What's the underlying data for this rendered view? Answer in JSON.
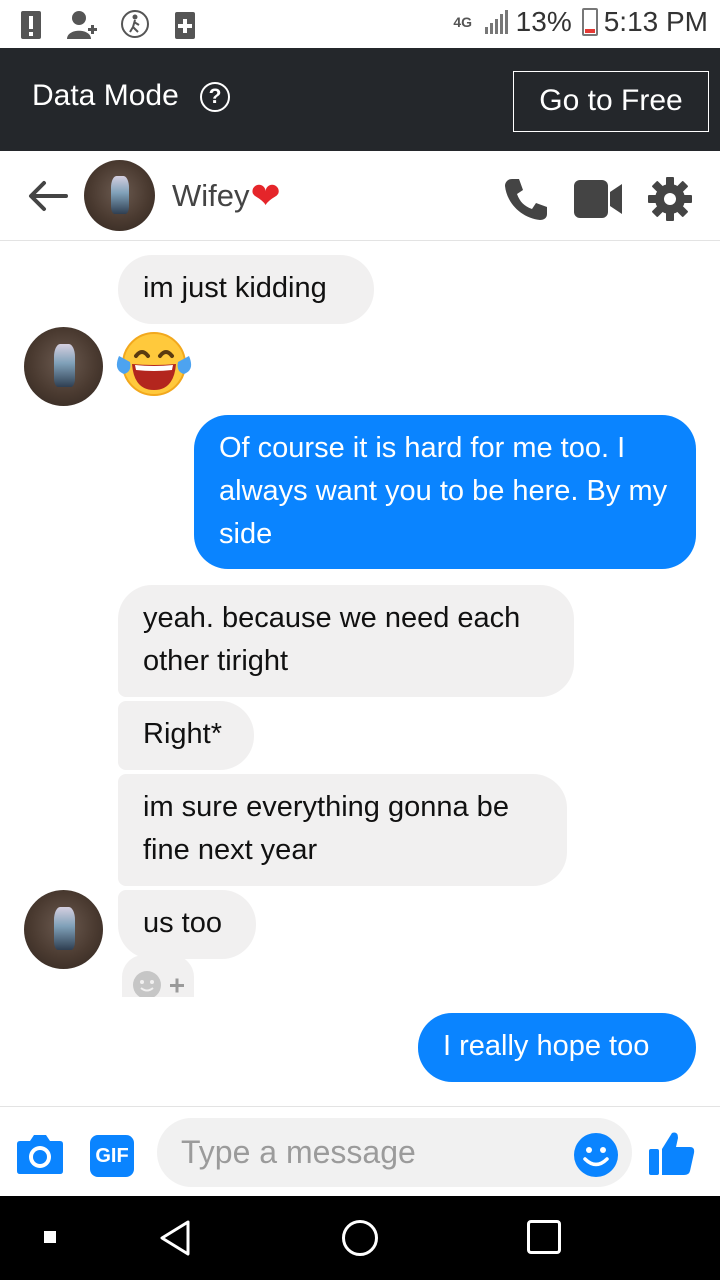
{
  "status_bar": {
    "network": "4G",
    "battery": "13%",
    "time": "5:13 PM",
    "icons": [
      "alert-icon",
      "add-person-icon",
      "accessibility-icon",
      "medical-icon",
      "signal-icon",
      "battery-icon"
    ]
  },
  "data_mode": {
    "label": "Data Mode",
    "help": "?",
    "button": "Go to Free"
  },
  "header": {
    "contact_name": "Wifey",
    "heart": "❤",
    "actions": [
      "call-icon",
      "video-call-icon",
      "settings-gear-icon"
    ]
  },
  "messages": [
    {
      "side": "in",
      "text": "im just kidding"
    },
    {
      "side": "in",
      "type": "emoji",
      "emoji": "face-with-tears-of-joy"
    },
    {
      "side": "out",
      "text": "Of course it is hard for me too. I always want you to be here. By my side"
    },
    {
      "side": "in",
      "text": "yeah. because we need each other tiright"
    },
    {
      "side": "in",
      "text": "Right*"
    },
    {
      "side": "in",
      "text": "im sure everything gonna be fine next year"
    },
    {
      "side": "in",
      "text": "us too"
    },
    {
      "side": "out",
      "text": "I really hope too"
    }
  ],
  "composer": {
    "gif_label": "GIF",
    "placeholder": "Type a message"
  },
  "colors": {
    "accent": "#0a84ff",
    "incoming_bubble": "#f1f0f0",
    "data_bar": "#24272b",
    "heart": "#e5252a"
  }
}
